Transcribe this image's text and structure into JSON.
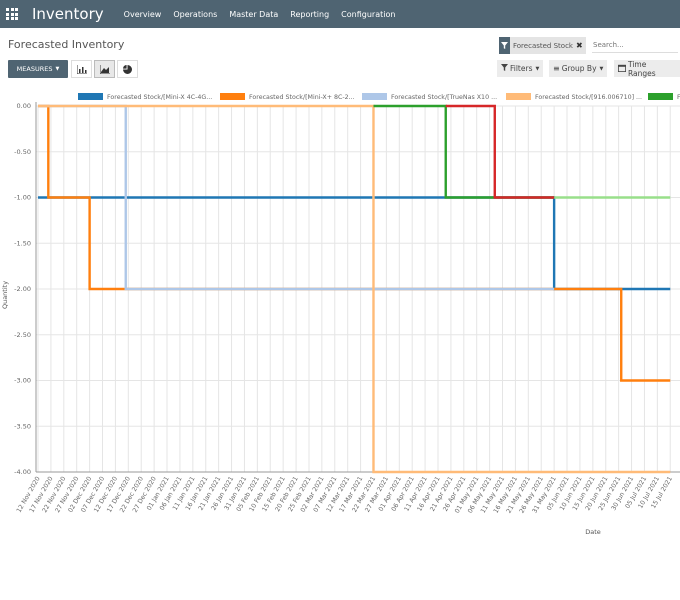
{
  "header": {
    "app_title": "Inventory",
    "menu": [
      "Overview",
      "Operations",
      "Master Data",
      "Reporting",
      "Configuration"
    ]
  },
  "breadcrumb": "Forecasted Inventory",
  "search": {
    "facet_label": "Forecasted Stock",
    "placeholder": "Search..."
  },
  "toolbar": {
    "measures_label": "MEASURES",
    "filters_label": "Filters",
    "group_by_label": "Group By",
    "time_ranges_label": "Time Ranges"
  },
  "colors": {
    "topbar": "#4f6472",
    "series": [
      "#1f77b4",
      "#ff7f0e",
      "#aec7e8",
      "#ffbb78",
      "#2ca02c",
      "#98df8a",
      "#d62728"
    ]
  },
  "chart_data": {
    "type": "line",
    "title": "",
    "xlabel": "Date",
    "ylabel": "Quantity",
    "ylim": [
      -4.0,
      0.0
    ],
    "y_ticks": [
      "0.00",
      "-0.50",
      "-1.00",
      "-1.50",
      "-2.00",
      "-2.50",
      "-3.00",
      "-3.50",
      "-4.00"
    ],
    "grid": true,
    "legend_position": "top",
    "categories": [
      "12 Nov 2020",
      "17 Nov 2020",
      "22 Nov 2020",
      "27 Nov 2020",
      "02 Dec 2020",
      "07 Dec 2020",
      "12 Dec 2020",
      "17 Dec 2020",
      "22 Dec 2020",
      "27 Dec 2020",
      "01 Jan 2021",
      "06 Jan 2021",
      "11 Jan 2021",
      "16 Jan 2021",
      "21 Jan 2021",
      "26 Jan 2021",
      "31 Jan 2021",
      "05 Feb 2021",
      "10 Feb 2021",
      "15 Feb 2021",
      "20 Feb 2021",
      "25 Feb 2021",
      "02 Mar 2021",
      "07 Mar 2021",
      "12 Mar 2021",
      "17 Mar 2021",
      "22 Mar 2021",
      "27 Mar 2021",
      "01 Apr 2021",
      "06 Apr 2021",
      "11 Apr 2021",
      "16 Apr 2021",
      "21 Apr 2021",
      "26 Apr 2021",
      "01 May 2021",
      "06 May 2021",
      "11 May 2021",
      "16 May 2021",
      "21 May 2021",
      "26 May 2021",
      "31 May 2021",
      "05 Jun 2021",
      "10 Jun 2021",
      "15 Jun 2021",
      "20 Jun 2021",
      "25 Jun 2021",
      "30 Jun 2021",
      "05 Jul 2021",
      "10 Jul 2021",
      "15 Jul 2021"
    ],
    "legend_labels": [
      "Forecasted Stock/[Mini-X 4C-4G...",
      "Forecasted Stock/[Mini-X+ 8C-2...",
      "Forecasted Stock/[TrueNas X10 ...",
      "Forecasted Stock/[916.006710] ...",
      "F"
    ],
    "series": [
      {
        "name": "Forecasted Stock/[Mini-X 4C-4G...",
        "steps": [
          [
            "12 Nov 2020",
            -1.0
          ],
          [
            "31 May 2021",
            -2.0
          ],
          [
            "15 Jul 2021",
            -2.0
          ]
        ]
      },
      {
        "name": "Forecasted Stock/[Mini-X+ 8C-2...",
        "steps": [
          [
            "12 Nov 2020",
            0.0
          ],
          [
            "16 Nov 2020",
            -1.0
          ],
          [
            "02 Dec 2020",
            -2.0
          ],
          [
            "26 Jun 2021",
            -3.0
          ],
          [
            "15 Jul 2021",
            -3.0
          ]
        ]
      },
      {
        "name": "Forecasted Stock/[TrueNas X10 ...",
        "steps": [
          [
            "12 Nov 2020",
            0.0
          ],
          [
            "16 Dec 2020",
            -2.0
          ],
          [
            "31 May 2021",
            -2.0
          ]
        ]
      },
      {
        "name": "Forecasted Stock/[916.006710] ...",
        "steps": [
          [
            "12 Nov 2020",
            0.0
          ],
          [
            "22 Mar 2021",
            -4.0
          ],
          [
            "15 Jul 2021",
            -4.0
          ]
        ]
      },
      {
        "name": "F",
        "steps": [
          [
            "22 Mar 2021",
            0.0
          ],
          [
            "19 Apr 2021",
            -1.0
          ],
          [
            "31 May 2021",
            -1.0
          ]
        ]
      },
      {
        "name": "",
        "steps": [
          [
            "31 May 2021",
            -1.0
          ],
          [
            "15 Jul 2021",
            -1.0
          ]
        ]
      },
      {
        "name": "",
        "steps": [
          [
            "19 Apr 2021",
            0.0
          ],
          [
            "08 May 2021",
            -1.0
          ],
          [
            "31 May 2021",
            -1.0
          ]
        ]
      }
    ]
  }
}
